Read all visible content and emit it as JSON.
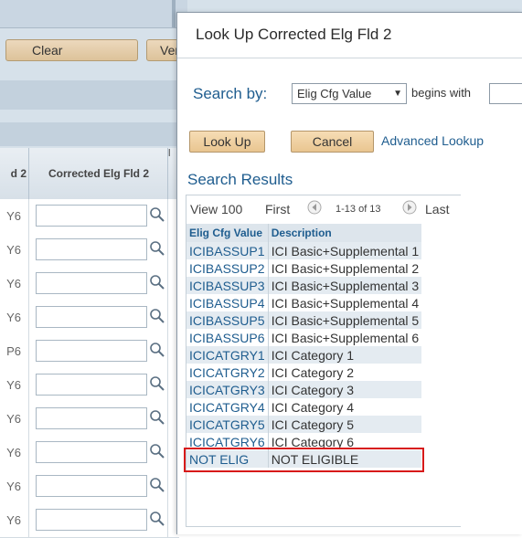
{
  "background": {
    "clear_label": "Clear",
    "ver_label": "Ver",
    "grid_header_left": "d 2",
    "grid_header_main": "Corrected Elg Fld 2",
    "grid_header_right": "l",
    "row_stubs": [
      "Y6",
      "Y6",
      "Y6",
      "Y6",
      "P6",
      "Y6",
      "Y6",
      "Y6",
      "Y6",
      "Y6"
    ]
  },
  "modal": {
    "title": "Look Up Corrected Elg Fld 2",
    "search_by_label": "Search by:",
    "search_field_value": "Elig Cfg Value",
    "search_operator": "begins with",
    "search_input_value": "",
    "lookup_button": "Look Up",
    "cancel_button": "Cancel",
    "advanced_link": "Advanced Lookup",
    "results_title": "Search Results",
    "nav": {
      "view": "View 100",
      "first": "First",
      "range": "1-13 of 13",
      "last": "Last"
    },
    "columns": [
      "Elig Cfg Value",
      "Description"
    ],
    "rows": [
      {
        "value": "ICIBASSUP1",
        "desc": "ICI Basic+Supplemental 1"
      },
      {
        "value": "ICIBASSUP2",
        "desc": "ICI Basic+Supplemental 2"
      },
      {
        "value": "ICIBASSUP3",
        "desc": "ICI Basic+Supplemental 3"
      },
      {
        "value": "ICIBASSUP4",
        "desc": "ICI Basic+Supplemental 4"
      },
      {
        "value": "ICIBASSUP5",
        "desc": "ICI Basic+Supplemental 5"
      },
      {
        "value": "ICIBASSUP6",
        "desc": "ICI Basic+Supplemental 6"
      },
      {
        "value": "ICICATGRY1",
        "desc": "ICI Category 1"
      },
      {
        "value": "ICICATGRY2",
        "desc": "ICI Category 2"
      },
      {
        "value": "ICICATGRY3",
        "desc": "ICI Category 3"
      },
      {
        "value": "ICICATGRY4",
        "desc": "ICI Category 4"
      },
      {
        "value": "ICICATGRY5",
        "desc": "ICI Category 5"
      },
      {
        "value": "ICICATGRY6",
        "desc": "ICI Category 6"
      },
      {
        "value": "NOT ELIG",
        "desc": "NOT ELIGIBLE"
      }
    ],
    "highlight_color": "#d71a1a"
  },
  "icons": {
    "lookup": "magnifier-icon",
    "prev": "prev-arrow-icon",
    "next": "next-arrow-icon",
    "dropdown": "chevron-down-icon"
  }
}
